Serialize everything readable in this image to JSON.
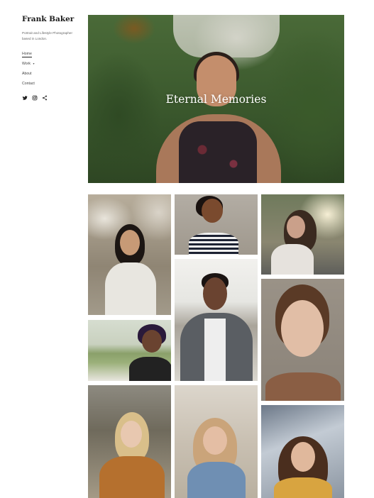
{
  "site": {
    "title": "Frank Baker",
    "tagline": "Portrait and Lifestyle Photographer based in London."
  },
  "nav": {
    "items": [
      {
        "label": "Home",
        "active": true
      },
      {
        "label": "Work",
        "has_dropdown": true
      },
      {
        "label": "About"
      },
      {
        "label": "Contact"
      }
    ]
  },
  "social": [
    "twitter-icon",
    "instagram-icon",
    "share-icon"
  ],
  "hero": {
    "title": "Eternal Memories"
  },
  "gallery": {
    "photos": [
      {
        "name": "portrait-blossom-woman"
      },
      {
        "name": "portrait-laughing-woman-stripes"
      },
      {
        "name": "portrait-woman-street-sunlight"
      },
      {
        "name": "portrait-man-denim-jacket"
      },
      {
        "name": "portrait-woman-purple-hair"
      },
      {
        "name": "portrait-woman-freckles"
      },
      {
        "name": "portrait-blonde-woman-mustard-jacket"
      },
      {
        "name": "portrait-blonde-woman-denim-jacket"
      },
      {
        "name": "portrait-woman-yellow-top"
      }
    ]
  },
  "colors": {
    "text": "#1a1a1a",
    "muted": "#666666",
    "background": "#ffffff"
  }
}
